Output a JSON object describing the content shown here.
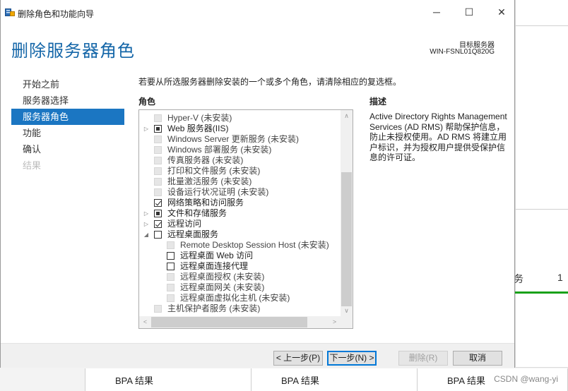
{
  "window": {
    "title": "删除角色和功能向导",
    "controls": {
      "minimize": "─",
      "maximize": "☐",
      "close": "✕"
    }
  },
  "header": {
    "page_title": "删除服务器角色",
    "target_label": "目标服务器",
    "target_value": "WIN-FSNL01Q820G"
  },
  "nav": [
    {
      "label": "开始之前",
      "state": "normal"
    },
    {
      "label": "服务器选择",
      "state": "normal"
    },
    {
      "label": "服务器角色",
      "state": "active"
    },
    {
      "label": "功能",
      "state": "normal"
    },
    {
      "label": "确认",
      "state": "normal"
    },
    {
      "label": "结果",
      "state": "disabled"
    }
  ],
  "instruction": "若要从所选服务器删除安装的一个或多个角色，请清除相应的复选框。",
  "roles_header": "角色",
  "description": {
    "header": "描述",
    "text": "Active Directory Rights Management Services (AD RMS) 帮助保护信息，防止未授权使用。AD RMS 将建立用户标识，并为授权用户提供受保护信息的许可证。"
  },
  "roles": [
    {
      "label": "Hyper-V (未安装)",
      "state": "disabled",
      "level": 0,
      "expander": ""
    },
    {
      "label": "Web 服务器(IIS)",
      "state": "partial",
      "level": 0,
      "expander": "▷"
    },
    {
      "label": "Windows Server 更新服务 (未安装)",
      "state": "disabled",
      "level": 0,
      "expander": ""
    },
    {
      "label": "Windows 部署服务 (未安装)",
      "state": "disabled",
      "level": 0,
      "expander": ""
    },
    {
      "label": "传真服务器 (未安装)",
      "state": "disabled",
      "level": 0,
      "expander": ""
    },
    {
      "label": "打印和文件服务 (未安装)",
      "state": "disabled",
      "level": 0,
      "expander": ""
    },
    {
      "label": "批量激活服务 (未安装)",
      "state": "disabled",
      "level": 0,
      "expander": ""
    },
    {
      "label": "设备运行状况证明 (未安装)",
      "state": "disabled",
      "level": 0,
      "expander": ""
    },
    {
      "label": "网络策略和访问服务",
      "state": "checked",
      "level": 0,
      "expander": ""
    },
    {
      "label": "文件和存储服务",
      "state": "partial",
      "level": 0,
      "expander": "▷"
    },
    {
      "label": "远程访问",
      "state": "checked",
      "level": 0,
      "expander": "▷"
    },
    {
      "label": "远程桌面服务",
      "state": "unchecked",
      "level": 0,
      "expander": "◢"
    },
    {
      "label": "Remote Desktop Session Host (未安装)",
      "state": "disabled",
      "level": 1,
      "expander": ""
    },
    {
      "label": "远程桌面 Web 访问",
      "state": "unchecked",
      "level": 1,
      "expander": ""
    },
    {
      "label": "远程桌面连接代理",
      "state": "unchecked",
      "level": 1,
      "expander": ""
    },
    {
      "label": "远程桌面授权 (未安装)",
      "state": "disabled",
      "level": 1,
      "expander": ""
    },
    {
      "label": "远程桌面网关 (未安装)",
      "state": "disabled",
      "level": 1,
      "expander": ""
    },
    {
      "label": "远程桌面虚拟化主机 (未安装)",
      "state": "disabled",
      "level": 1,
      "expander": ""
    },
    {
      "label": "主机保护者服务 (未安装)",
      "state": "disabled",
      "level": 0,
      "expander": ""
    }
  ],
  "scroll": {
    "up": "∧",
    "down": "∨",
    "left": "<",
    "right": ">"
  },
  "buttons": {
    "previous": "< 上一步(P)",
    "next": "下一步(N) >",
    "remove": "删除(R)",
    "cancel": "取消"
  },
  "background": {
    "tile_text_fragment": "务",
    "tile_count": "1",
    "bpa_label": "BPA 结果",
    "watermark": "CSDN @wang-yi"
  },
  "colors": {
    "accent": "#1b76c2",
    "title_blue": "#1466a8",
    "status_green": "#19a119"
  }
}
